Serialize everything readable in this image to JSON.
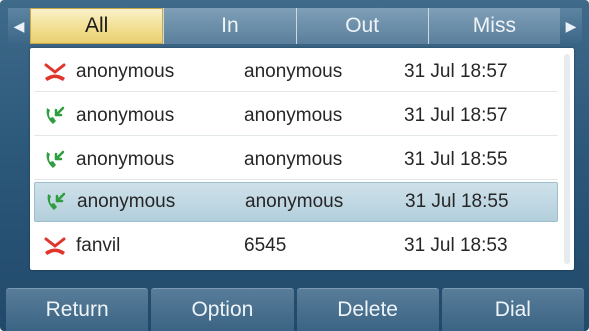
{
  "tabs": {
    "left_arrow": "◀",
    "right_arrow": "▶",
    "items": [
      {
        "label": "All"
      },
      {
        "label": "In"
      },
      {
        "label": "Out"
      },
      {
        "label": "Miss"
      }
    ],
    "active_index": 0
  },
  "calls": [
    {
      "type": "missed-call-icon",
      "name": "anonymous",
      "number": "anonymous",
      "time": "31 Jul 18:57"
    },
    {
      "type": "incoming-call-icon",
      "name": "anonymous",
      "number": "anonymous",
      "time": "31 Jul 18:57"
    },
    {
      "type": "incoming-call-icon",
      "name": "anonymous",
      "number": "anonymous",
      "time": "31 Jul 18:55"
    },
    {
      "type": "incoming-call-icon",
      "name": "anonymous",
      "number": "anonymous",
      "time": "31 Jul 18:55",
      "selected": true
    },
    {
      "type": "missed-call-icon",
      "name": "fanvil",
      "number": "6545",
      "time": "31 Jul 18:53"
    }
  ],
  "softkeys": [
    {
      "label": "Return"
    },
    {
      "label": "Option"
    },
    {
      "label": "Delete"
    },
    {
      "label": "Dial"
    }
  ],
  "colors": {
    "missed": "#e0352b",
    "incoming": "#2f9e3f",
    "active_tab": "#f2df92"
  }
}
